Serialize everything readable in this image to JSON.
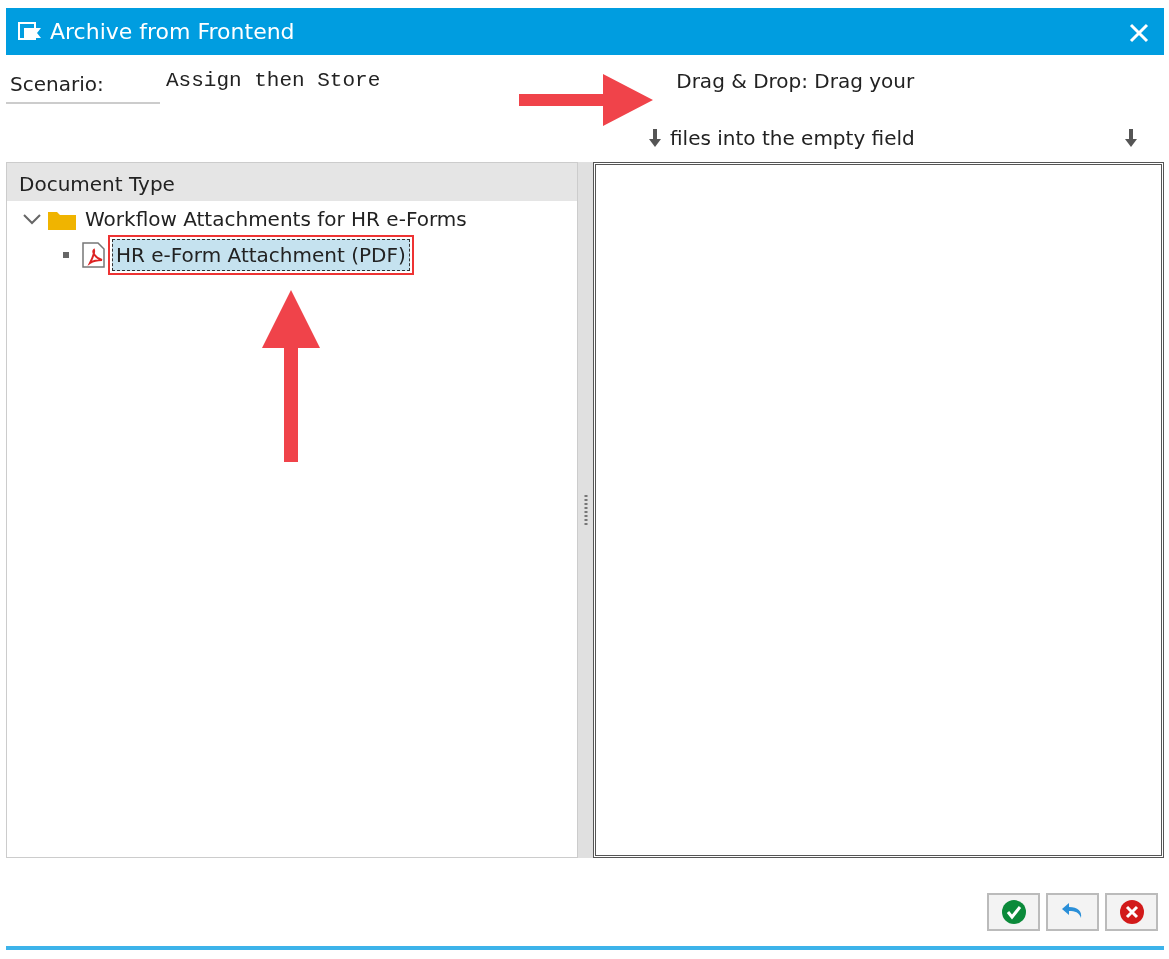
{
  "window": {
    "title": "Archive from Frontend"
  },
  "scenario": {
    "label": "Scenario:",
    "value": "Assign then Store"
  },
  "hint": {
    "line_1": "Drag & Drop: Drag your",
    "line_2": "files into the empty field"
  },
  "tree": {
    "header": "Document Type",
    "items": [
      {
        "label": "Workflow Attachments for HR e-Forms",
        "kind": "folder",
        "expanded": true,
        "selected": false,
        "children": [
          {
            "label": "HR e-Form Attachment (PDF)",
            "kind": "pdf",
            "selected": true
          }
        ]
      }
    ]
  },
  "buttons": [
    {
      "kind": "confirm"
    },
    {
      "kind": "undo"
    },
    {
      "kind": "cancel"
    }
  ]
}
